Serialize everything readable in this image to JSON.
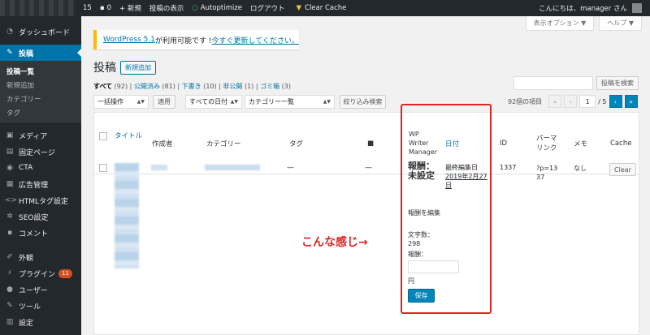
{
  "adminbar": {
    "updates_count": "15",
    "comments_count": "0",
    "new_label": "+ 新規",
    "view_posts": "投稿の表示",
    "autoptimize": "Autoptimize",
    "logout": "ログアウト",
    "clear_cache": "Clear Cache",
    "greeting": "こんにちは、manager さん"
  },
  "sidebar": {
    "dashboard": "ダッシュボード",
    "posts": "投稿",
    "submenu": [
      "投稿一覧",
      "新規追加",
      "カテゴリー",
      "タグ"
    ],
    "items": [
      "メディア",
      "固定ページ",
      "CTA",
      "広告管理",
      "HTMLタグ設定",
      "SEO設定",
      "コメント"
    ],
    "appearance": "外観",
    "plugins": "プラグイン",
    "plugins_badge": "11",
    "users": "ユーザー",
    "tools": "ツール",
    "settings": "設定"
  },
  "screen_tabs": {
    "options": "表示オプション ▼",
    "help": "ヘルプ ▼"
  },
  "notice": {
    "version_link": "WordPress 5.1",
    "text": " が利用可能です ! ",
    "update_link": "今すぐ更新してください。"
  },
  "page": {
    "title": "投稿",
    "add_new": "新規追加"
  },
  "filters": {
    "all": "すべて",
    "all_count": "(92)",
    "published": "公開済み",
    "published_count": "(81)",
    "draft": "下書き",
    "draft_count": "(10)",
    "private": "非公開",
    "private_count": "(1)",
    "trash": "ゴミ箱",
    "trash_count": "(3)",
    "sep": "|"
  },
  "search": {
    "placeholder": "",
    "button": "投稿を検索"
  },
  "tablenav": {
    "bulk": "一括操作",
    "apply": "適用",
    "dates": "すべての日付",
    "category": "カテゴリー一覧",
    "filter": "絞り込み検索",
    "items_count": "92個の項目",
    "first": "«",
    "prev": "‹",
    "current_page": "1",
    "of_pages": "/ 5",
    "next": "›",
    "last": "»"
  },
  "columns": {
    "title": "タイトル",
    "author": "作成者",
    "category": "カテゴリー",
    "tags": "タグ",
    "wpwm": "WP Writer Manager",
    "date": "日付",
    "id": "ID",
    "permalink": "パーマリンク",
    "memo": "メモ",
    "cache": "Cache"
  },
  "row": {
    "tags": "—",
    "comments": "—",
    "fee_title": "報酬：未設定",
    "edit_fee": "報酬を編集",
    "char_label": "文字数：",
    "char_count": "298",
    "fee_label": "報酬：",
    "yen": "円",
    "save": "保存",
    "date_status": "最終編集日",
    "date_value": "2019年2月27日",
    "id": "1337",
    "permalink": "?p=1337",
    "memo": "なし",
    "clear": "Clear"
  },
  "annotation": "こんな感じ→",
  "colors": {
    "adminbar": "#23282d",
    "accent": "#0073aa",
    "annotation": "#e02424"
  }
}
